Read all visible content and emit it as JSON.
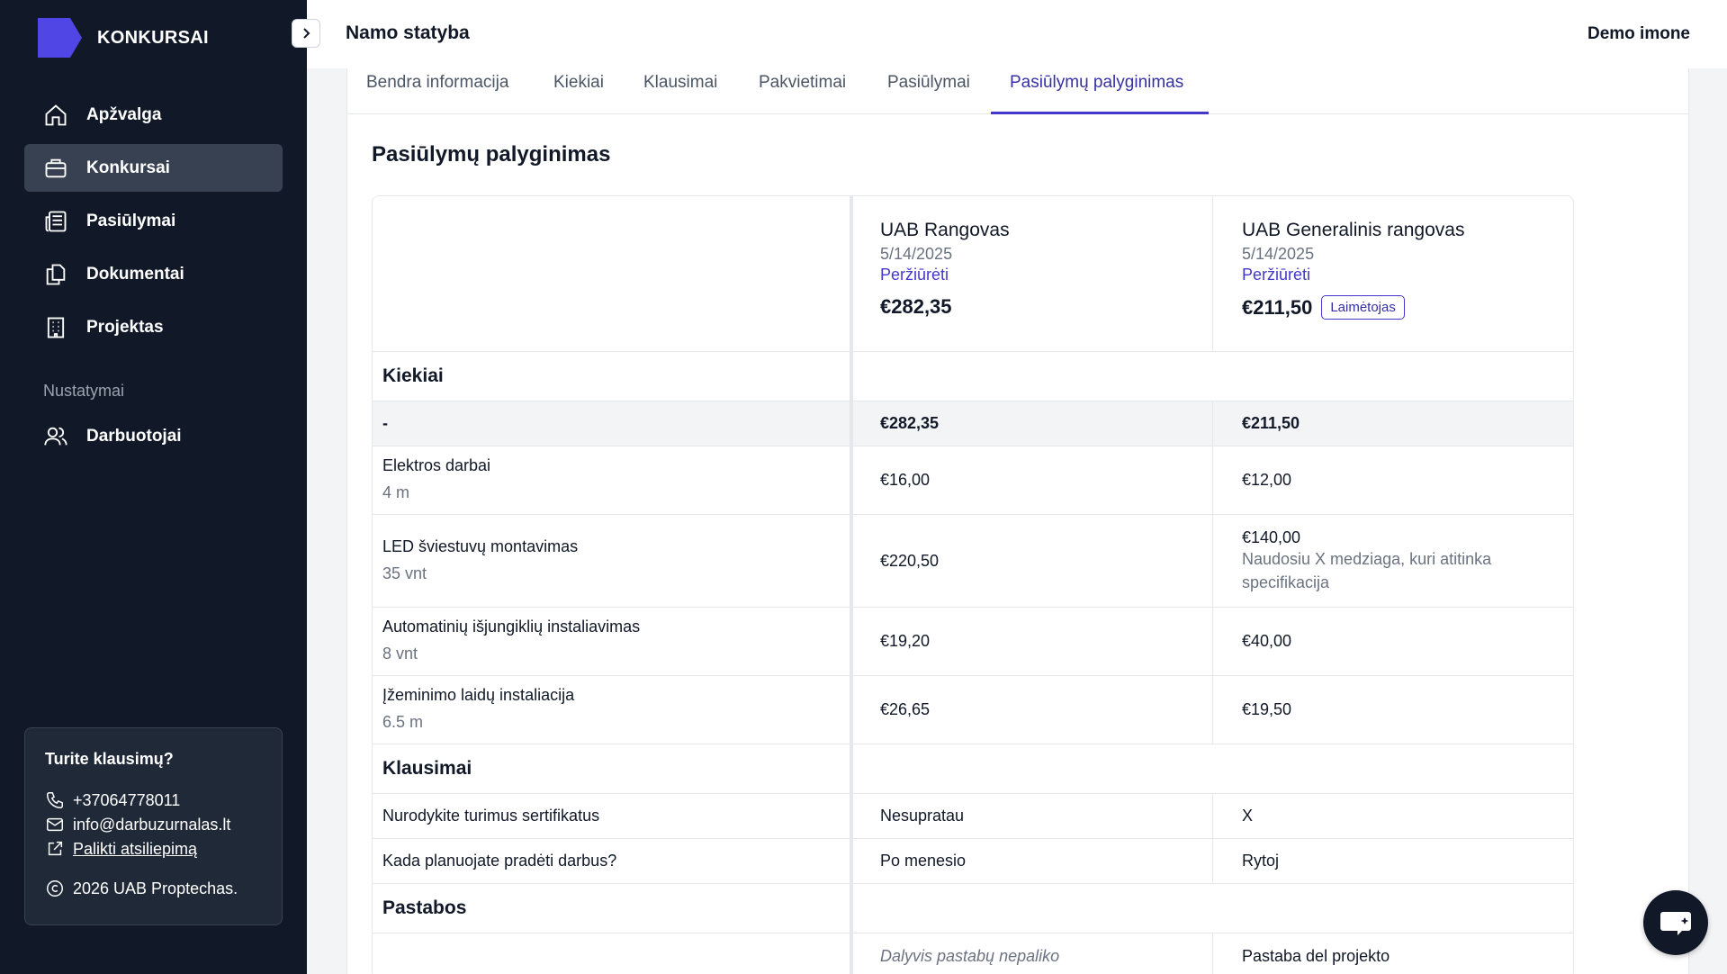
{
  "app": {
    "name": "KONKURSAI",
    "brand_color": "#4f46e5"
  },
  "sidebar": {
    "items": [
      {
        "label": "Apžvalga",
        "icon": "home-icon"
      },
      {
        "label": "Konkursai",
        "icon": "briefcase-icon",
        "active": true
      },
      {
        "label": "Pasiūlymai",
        "icon": "newspaper-icon"
      },
      {
        "label": "Dokumentai",
        "icon": "documents-icon"
      },
      {
        "label": "Projektas",
        "icon": "building-icon"
      }
    ],
    "settings_heading": "Nustatymai",
    "settings_items": [
      {
        "label": "Darbuotojai",
        "icon": "users-icon"
      }
    ],
    "help": {
      "title": "Turite klausimų?",
      "phone": "+37064778011",
      "email": "info@darbuzurnalas.lt",
      "feedback_link": "Palikti atsiliepimą",
      "copyright": "2026 UAB Proptechas."
    }
  },
  "header": {
    "title": "Namo statyba",
    "org": "Demo imone"
  },
  "tabs": [
    {
      "label": "Bendra informacija"
    },
    {
      "label": "Kiekiai"
    },
    {
      "label": "Klausimai"
    },
    {
      "label": "Pakvietimai"
    },
    {
      "label": "Pasiūlymai"
    },
    {
      "label": "Pasiūlymų palyginimas",
      "active": true
    }
  ],
  "comparison": {
    "title": "Pasiūlymų palyginimas",
    "bidders": [
      {
        "name": "UAB Rangovas",
        "date": "5/14/2025",
        "link": "Peržiūrėti",
        "total": "€282,35"
      },
      {
        "name": "UAB Generalinis rangovas",
        "date": "5/14/2025",
        "link": "Peržiūrėti",
        "total": "€211,50",
        "badge": "Laimėtojas"
      }
    ],
    "quantities": {
      "heading": "Kiekiai",
      "subtotal": {
        "label": "-",
        "values": [
          "€282,35",
          "€211,50"
        ]
      },
      "rows": [
        {
          "name": "Elektros darbai",
          "qty": "4 m",
          "values": [
            "€16,00",
            "€12,00"
          ],
          "note": ""
        },
        {
          "name": "LED šviestuvų montavimas",
          "qty": "35 vnt",
          "values": [
            "€220,50",
            "€140,00"
          ],
          "note": "Naudosiu X medziaga, kuri atitinka specifikacija"
        },
        {
          "name": "Automatinių išjungiklių instaliavimas",
          "qty": "8 vnt",
          "values": [
            "€19,20",
            "€40,00"
          ],
          "note": ""
        },
        {
          "name": "Įžeminimo laidų instaliacija",
          "qty": "6.5 m",
          "values": [
            "€26,65",
            "€19,50"
          ],
          "note": ""
        }
      ]
    },
    "questions": {
      "heading": "Klausimai",
      "rows": [
        {
          "question": "Nurodykite turimus sertifikatus",
          "answers": [
            "Nesupratau",
            "X"
          ]
        },
        {
          "question": "Kada planuojate pradėti darbus?",
          "answers": [
            "Po menesio",
            "Rytoj"
          ]
        }
      ]
    },
    "notes": {
      "heading": "Pastabos",
      "values": [
        "Dalyvis pastabų nepaliko",
        "Pastaba del projekto"
      ]
    }
  }
}
